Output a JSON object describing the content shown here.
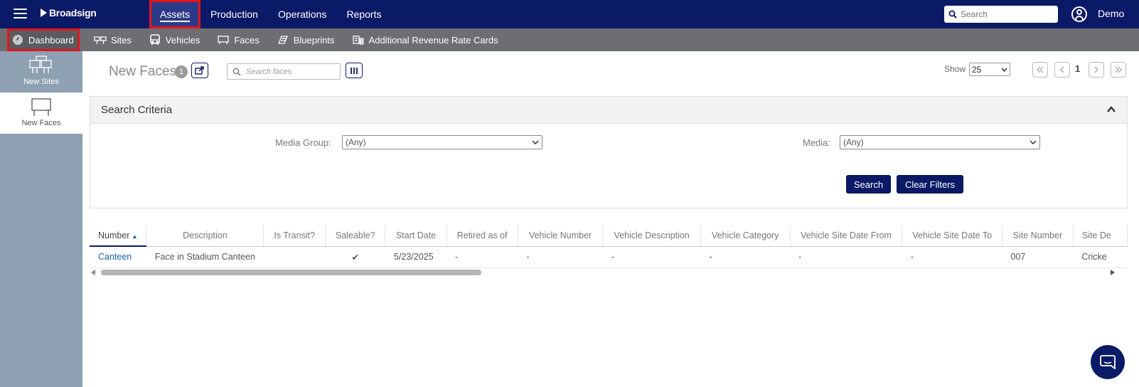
{
  "app": {
    "brand": "Broadsign"
  },
  "topnav": {
    "items": [
      {
        "label": "Assets"
      },
      {
        "label": "Production"
      },
      {
        "label": "Operations"
      },
      {
        "label": "Reports"
      }
    ],
    "search_placeholder": "Search",
    "user_name": "Demo"
  },
  "subnav": {
    "dashboard": "Dashboard",
    "items": [
      {
        "label": "Sites",
        "icon": "sites-icon"
      },
      {
        "label": "Vehicles",
        "icon": "bus-icon"
      },
      {
        "label": "Faces",
        "icon": "face-icon"
      },
      {
        "label": "Blueprints",
        "icon": "blueprint-icon"
      },
      {
        "label": "Additional Revenue Rate Cards",
        "icon": "rate-card-icon"
      }
    ]
  },
  "sidebar": {
    "items": [
      {
        "label": "New Sites"
      },
      {
        "label": "New Faces"
      }
    ]
  },
  "page": {
    "title": "New Faces",
    "count": "1",
    "search_placeholder": "Search faces",
    "show_label": "Show",
    "page_size": "25",
    "current_page": "1"
  },
  "criteria": {
    "title": "Search Criteria",
    "media_group_label": "Media Group:",
    "media_group_value": "(Any)",
    "media_label": "Media:",
    "media_value": "(Any)",
    "search_button": "Search",
    "clear_button": "Clear Filters"
  },
  "table": {
    "columns": [
      "Number",
      "Description",
      "Is Transit?",
      "Saleable?",
      "Start Date",
      "Retired as of",
      "Vehicle Number",
      "Vehicle Description",
      "Vehicle Category",
      "Vehicle Site Date From",
      "Vehicle Site Date To",
      "Site Number",
      "Site De"
    ],
    "rows": [
      [
        "Canteen",
        "Face in Stadium Canteen",
        "",
        "✔",
        "5/23/2025",
        "-",
        "-",
        "-",
        "-",
        "-",
        "-",
        "007",
        "Cricke"
      ]
    ]
  },
  "colors": {
    "navy": "#0b1a66",
    "subnav_gray": "#6d6e72",
    "sidebar_blue": "#8ea1b3",
    "highlight_red": "#e4141b",
    "link_blue": "#1a5fb4"
  }
}
